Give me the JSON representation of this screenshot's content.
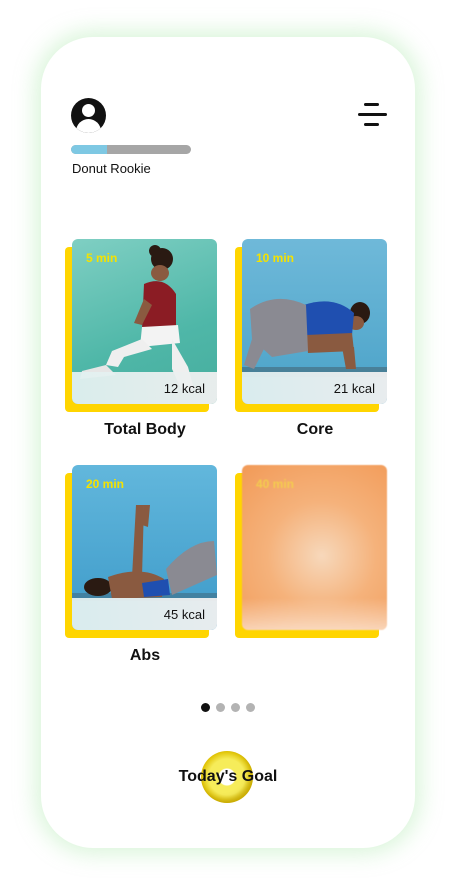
{
  "header": {
    "avatar_icon": "user-circle-icon",
    "menu_icon": "hamburger-menu-icon",
    "progress": 0.3,
    "rank_label": "Donut Rookie"
  },
  "workouts": [
    {
      "minutes": "5 min",
      "kcal": "12 kcal",
      "title": "Total Body"
    },
    {
      "minutes": "10 min",
      "kcal": "21 kcal",
      "title": "Core"
    },
    {
      "minutes": "20 min",
      "kcal": "45 kcal",
      "title": "Abs"
    },
    {
      "minutes": "40 min",
      "kcal": "",
      "title": ""
    }
  ],
  "pager": {
    "count": 4,
    "active": 0
  },
  "goal": {
    "label": "Today's Goal",
    "icon": "donut-icon"
  },
  "colors": {
    "accent_yellow": "#ffd500",
    "progress_fill": "#7ec8e3",
    "progress_track": "#a6a6a6",
    "glow": "#96e196"
  }
}
